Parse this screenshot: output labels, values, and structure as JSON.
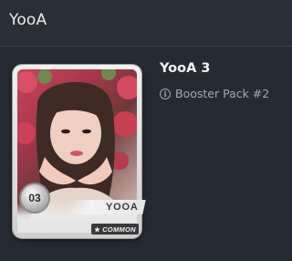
{
  "header": {
    "title": "YooA"
  },
  "card": {
    "number": "03",
    "name_label": "YOOA",
    "rarity": "COMMON",
    "rarity_icon": "star-icon"
  },
  "details": {
    "title": "YooA 3",
    "pack_icon": "info-icon",
    "pack_label": "Booster Pack #2"
  },
  "colors": {
    "background": "#262a33",
    "header_background": "#2a2e37",
    "title_text": "#f2f4f7",
    "muted_text": "#a3a9b4"
  }
}
